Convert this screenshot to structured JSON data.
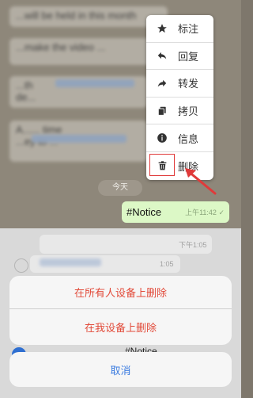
{
  "chat": {
    "messages_top": [
      {
        "text": "...will be held in this month"
      },
      {
        "text": "...make the video ..."
      },
      {
        "text": "...th"
      },
      {
        "text": "de..."
      },
      {
        "text": "A...... time"
      },
      {
        "text": "...ey to ..."
      }
    ],
    "date_separator": "今天",
    "notice_message": {
      "text": "#Notice",
      "time": "上午11:42",
      "status": "✓"
    },
    "dimmed_times": [
      "下午1:05",
      "1:05"
    ],
    "dimmed_notice": "#Notice"
  },
  "context_menu": {
    "items": [
      {
        "label": "标注",
        "icon": "star-icon"
      },
      {
        "label": "回复",
        "icon": "reply-icon"
      },
      {
        "label": "转发",
        "icon": "forward-icon"
      },
      {
        "label": "拷贝",
        "icon": "copy-icon"
      },
      {
        "label": "信息",
        "icon": "info-icon"
      },
      {
        "label": "删除",
        "icon": "trash-icon"
      }
    ]
  },
  "action_sheet": {
    "delete_for_everyone": "在所有人设备上删除",
    "delete_for_me": "在我设备上删除",
    "cancel": "取消"
  },
  "colors": {
    "accent_red": "#e24b3a",
    "cancel_blue": "#3a7be0",
    "notice_bubble": "#dcf8c6",
    "highlight_red": "#e03a3a"
  }
}
